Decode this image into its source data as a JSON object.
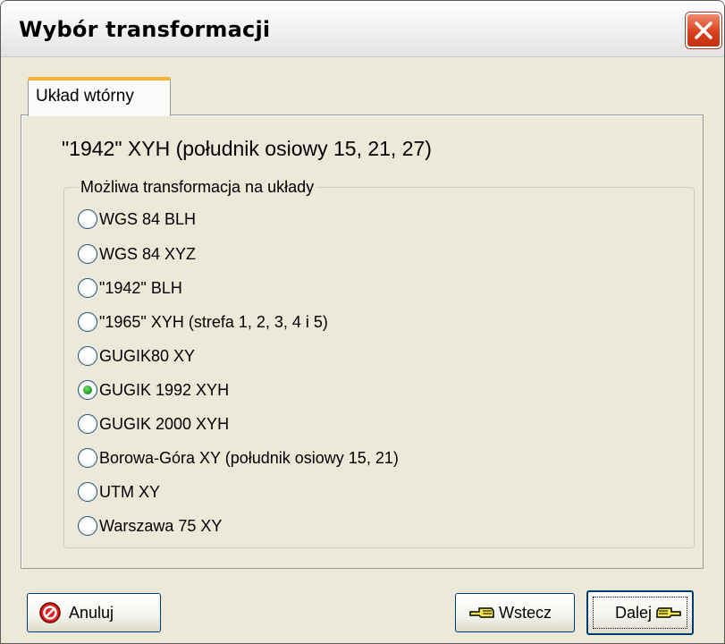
{
  "window": {
    "title": "Wybór transformacji"
  },
  "tabs": [
    {
      "label": "Układ wtórny"
    }
  ],
  "source_system": "\"1942\" XYH (południk osiowy 15, 21, 27)",
  "group": {
    "legend": "Możliwa transformacja na układy",
    "options": [
      {
        "label": "WGS 84 BLH",
        "checked": false
      },
      {
        "label": "WGS 84 XYZ",
        "checked": false
      },
      {
        "label": "\"1942\" BLH",
        "checked": false
      },
      {
        "label": "\"1965\" XYH (strefa 1, 2, 3, 4 i 5)",
        "checked": false
      },
      {
        "label": "GUGIK80 XY",
        "checked": false
      },
      {
        "label": "GUGIK 1992 XYH",
        "checked": true
      },
      {
        "label": "GUGIK 2000 XYH",
        "checked": false
      },
      {
        "label": "Borowa-Góra XY (południk osiowy 15, 21)",
        "checked": false
      },
      {
        "label": "UTM XY",
        "checked": false
      },
      {
        "label": "Warszawa 75 XY",
        "checked": false
      }
    ]
  },
  "buttons": {
    "cancel": "Anuluj",
    "back": "Wstecz",
    "next": "Dalej"
  },
  "icons": {
    "close": "close-icon",
    "cancel": "stop-icon",
    "back": "hand-pointing-left-icon",
    "next": "hand-pointing-right-icon"
  },
  "colors": {
    "close_button": "#d9411f",
    "tab_highlight": "#f2b233",
    "radio_selected": "#21a121"
  }
}
